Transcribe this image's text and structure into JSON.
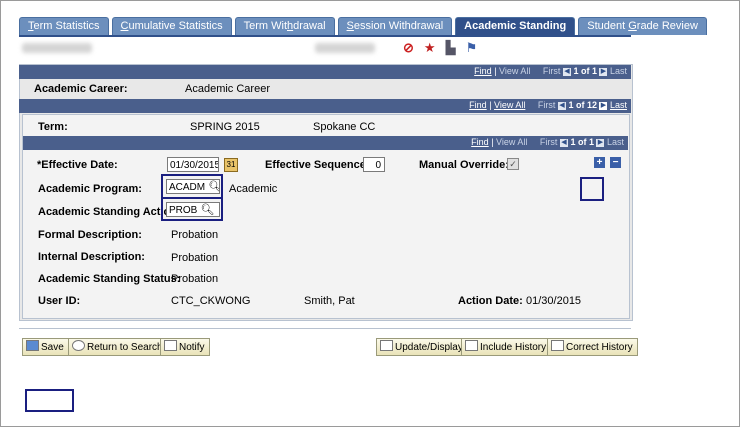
{
  "tabs": [
    {
      "pre": "",
      "ul": "T",
      "post": "erm Statistics",
      "active": false
    },
    {
      "pre": "",
      "ul": "C",
      "post": "umulative Statistics",
      "active": false
    },
    {
      "pre": "Term Wit",
      "ul": "h",
      "post": "drawal",
      "active": false
    },
    {
      "pre": "",
      "ul": "S",
      "post": "ession Withdrawal",
      "active": false
    },
    {
      "pre": "Academic Standing",
      "ul": "",
      "post": "",
      "active": true
    },
    {
      "pre": "Student ",
      "ul": "G",
      "post": "rade Review",
      "active": false
    }
  ],
  "nav1": {
    "find": "Find",
    "sep": " | ",
    "view_all": "View All",
    "first": "First",
    "count": "1 of 1",
    "last": "Last"
  },
  "career": {
    "label": "Academic Career:",
    "value": "Academic Career"
  },
  "nav2": {
    "find": "Find",
    "sep": " | ",
    "view_all": "View All",
    "first": "First",
    "count": "1 of 12",
    "last": "Last"
  },
  "term": {
    "label": "Term:",
    "value": "SPRING 2015",
    "campus": "Spokane CC"
  },
  "nav3": {
    "find": "Find",
    "sep": " | ",
    "view_all": "View All",
    "first": "First",
    "count": "1 of 1",
    "last": "Last"
  },
  "form": {
    "effective_date_label": "*Effective Date:",
    "effective_date": "01/30/2015",
    "effective_seq_label": "Effective Sequence:",
    "effective_seq": "0",
    "manual_override_label": "Manual Override:",
    "program_label": "Academic Program:",
    "program": "ACADM",
    "program_desc": "Academic",
    "action_label": "Academic Standing Action:",
    "action": "PROB",
    "formal_label": "Formal Description:",
    "formal": "Probation",
    "internal_label": "Internal Description:",
    "internal": "Probation",
    "status_label": "Academic Standing Status:",
    "status": "Probation",
    "userid_label": "User ID:",
    "userid": "CTC_CKWONG",
    "username": "Smith, Pat",
    "action_date_label": "Action Date:",
    "action_date": "01/30/2015"
  },
  "buttons": {
    "save": "Save",
    "return": "Return to Search",
    "notify": "Notify",
    "update": "Update/Display",
    "include": "Include History",
    "correct": "Correct History"
  },
  "icons": [
    "no-entry-icon",
    "star-icon",
    "building-icon",
    "flag-icon"
  ],
  "colors": {
    "tab": "#6c8fbd",
    "tab_active": "#30508a",
    "bar": "#4a5f8c",
    "highlight": "#1a1f80"
  }
}
